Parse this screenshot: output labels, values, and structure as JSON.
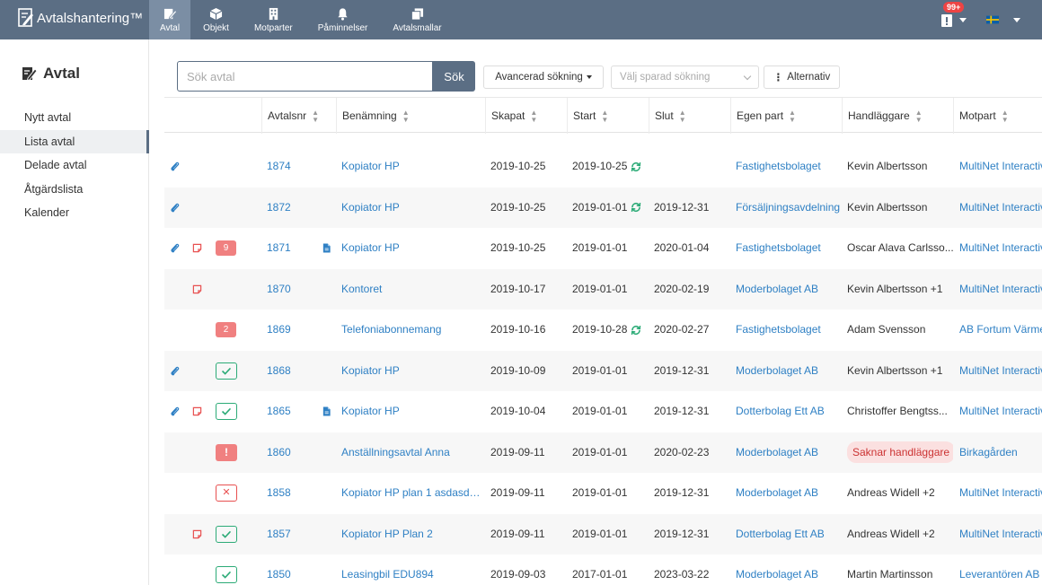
{
  "app": {
    "title": "Avtalshantering™"
  },
  "nav": [
    {
      "label": "Avtal",
      "icon": "contract-icon",
      "active": true
    },
    {
      "label": "Objekt",
      "icon": "cube-icon",
      "active": false
    },
    {
      "label": "Motparter",
      "icon": "building-icon",
      "active": false
    },
    {
      "label": "Påminnelser",
      "icon": "bell-icon",
      "active": false
    },
    {
      "label": "Avtalsmallar",
      "icon": "copy-icon",
      "active": false
    }
  ],
  "topright": {
    "notification_count": "99+",
    "language_flag": "Swedish flag"
  },
  "sidebar": {
    "title": "Avtal",
    "items": [
      {
        "label": "Nytt avtal",
        "active": false
      },
      {
        "label": "Lista avtal",
        "active": true
      },
      {
        "label": "Delade avtal",
        "active": false
      },
      {
        "label": "Åtgärdslista",
        "active": false
      },
      {
        "label": "Kalender",
        "active": false
      }
    ]
  },
  "search": {
    "placeholder": "Sök avtal",
    "button": "Sök",
    "advanced": "Avancerad sökning",
    "saved_placeholder": "Välj sparad sökning",
    "options": "Alternativ"
  },
  "table": {
    "columns": [
      "Avtalsnr",
      "Benämning",
      "Skapat",
      "Start",
      "Slut",
      "Egen part",
      "Handläggare",
      "Motpart"
    ],
    "rows": [
      {
        "attach": true,
        "note": false,
        "status": "",
        "badge": "",
        "nr": "1874",
        "doc": false,
        "name": "Kopiator HP",
        "created": "2019-10-25",
        "start": "2019-10-25",
        "renew": true,
        "end": "",
        "own": "Fastighetsbolaget",
        "handler": "Kevin Albertsson",
        "handler_pill": false,
        "party": "MultiNet Interactive"
      },
      {
        "attach": true,
        "note": false,
        "status": "",
        "badge": "",
        "nr": "1872",
        "doc": false,
        "name": "Kopiator HP",
        "created": "2019-10-25",
        "start": "2019-01-01",
        "renew": true,
        "end": "2019-12-31",
        "own": "Försäljningsavdelning",
        "handler": "Kevin Albertsson",
        "handler_pill": false,
        "party": "MultiNet Interactive"
      },
      {
        "attach": true,
        "note": true,
        "status": "",
        "badge": "9",
        "nr": "1871",
        "doc": true,
        "name": "Kopiator HP",
        "created": "2019-10-25",
        "start": "2019-01-01",
        "renew": false,
        "end": "2020-01-04",
        "own": "Fastighetsbolaget",
        "handler": "Oscar Alava Carlsso...",
        "handler_pill": false,
        "party": "MultiNet Interactive"
      },
      {
        "attach": false,
        "note": true,
        "status": "",
        "badge": "",
        "nr": "1870",
        "doc": false,
        "name": "Kontoret",
        "created": "2019-10-17",
        "start": "2019-01-01",
        "renew": false,
        "end": "2020-02-19",
        "own": "Moderbolaget AB",
        "handler": "Kevin Albertsson +1",
        "handler_pill": false,
        "party": "MultiNet Interactive"
      },
      {
        "attach": false,
        "note": false,
        "status": "",
        "badge": "2",
        "nr": "1869",
        "doc": false,
        "name": "Telefoniabonnemang",
        "created": "2019-10-16",
        "start": "2019-10-28",
        "renew": true,
        "end": "2020-02-27",
        "own": "Fastighetsbolaget",
        "handler": "Adam Svensson",
        "handler_pill": false,
        "party": "AB Fortum Värme"
      },
      {
        "attach": true,
        "note": false,
        "status": "ok",
        "badge": "",
        "nr": "1868",
        "doc": false,
        "name": "Kopiator HP",
        "created": "2019-10-09",
        "start": "2019-01-01",
        "renew": false,
        "end": "2019-12-31",
        "own": "Moderbolaget AB",
        "handler": "Kevin Albertsson +1",
        "handler_pill": false,
        "party": "MultiNet Interactive"
      },
      {
        "attach": true,
        "note": true,
        "status": "ok",
        "badge": "",
        "nr": "1865",
        "doc": true,
        "name": "Kopiator HP",
        "created": "2019-10-04",
        "start": "2019-01-01",
        "renew": false,
        "end": "2019-12-31",
        "own": "Dotterbolag Ett AB",
        "handler": "Christoffer Bengtss...",
        "handler_pill": false,
        "party": "MultiNet Interactive"
      },
      {
        "attach": false,
        "note": false,
        "status": "warn",
        "badge": "",
        "nr": "1860",
        "doc": false,
        "name": "Anställningsavtal Anna",
        "created": "2019-09-11",
        "start": "2019-01-01",
        "renew": false,
        "end": "2020-02-23",
        "own": "Moderbolaget AB",
        "handler": "Saknar handläggare",
        "handler_pill": true,
        "party": "Birkagården"
      },
      {
        "attach": false,
        "note": false,
        "status": "no",
        "badge": "",
        "nr": "1858",
        "doc": false,
        "name": "Kopiator HP plan 1 asdasda...",
        "created": "2019-09-11",
        "start": "2019-01-01",
        "renew": false,
        "end": "2019-12-31",
        "own": "Moderbolaget AB",
        "handler": "Andreas Widell +2",
        "handler_pill": false,
        "party": "MultiNet Interactive"
      },
      {
        "attach": false,
        "note": true,
        "status": "ok",
        "badge": "",
        "nr": "1857",
        "doc": false,
        "name": "Kopiator HP Plan 2",
        "created": "2019-09-11",
        "start": "2019-01-01",
        "renew": false,
        "end": "2019-12-31",
        "own": "Dotterbolag Ett AB",
        "handler": "Andreas Widell +2",
        "handler_pill": false,
        "party": "MultiNet Interactive"
      },
      {
        "attach": false,
        "note": false,
        "status": "ok",
        "badge": "",
        "nr": "1850",
        "doc": false,
        "name": "Leasingbil EDU894",
        "created": "2019-09-03",
        "start": "2017-01-01",
        "renew": false,
        "end": "2023-03-22",
        "own": "Moderbolaget AB",
        "handler": "Martin Martinsson",
        "handler_pill": false,
        "party": "Leverantören AB"
      }
    ]
  },
  "colors": {
    "topbar": "#5b6e84",
    "link": "#2f80c4",
    "ok": "#2cab77",
    "alert": "#f08080"
  }
}
